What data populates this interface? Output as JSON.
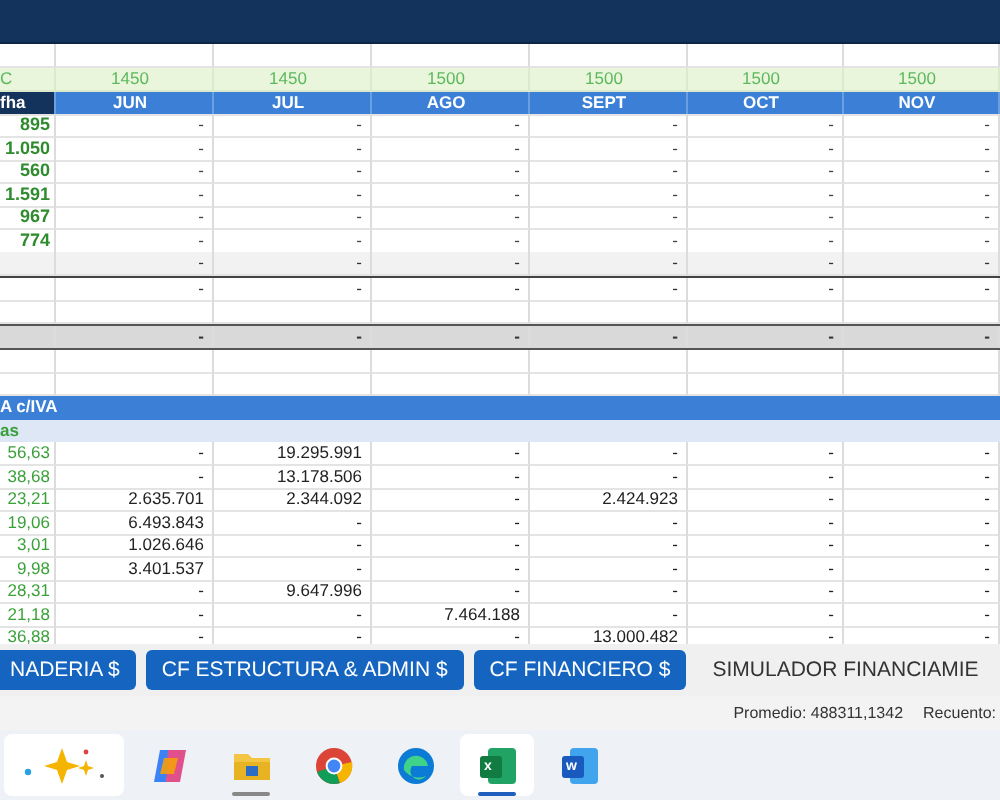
{
  "sheet": {
    "rate_row": [
      "C",
      "1450",
      "1450",
      "1500",
      "1500",
      "1500",
      "1500"
    ],
    "month_row": [
      "fha",
      "JUN",
      "JUL",
      "AGO",
      "SEPT",
      "OCT",
      "NOV"
    ],
    "rows": [
      {
        "kind": "top",
        "label": "895",
        "values": [
          "-",
          "-",
          "-",
          "-",
          "-",
          "-"
        ]
      },
      {
        "kind": "top",
        "label": "1.050",
        "values": [
          "-",
          "-",
          "-",
          "-",
          "-",
          "-"
        ]
      },
      {
        "kind": "top",
        "label": "560",
        "values": [
          "-",
          "-",
          "-",
          "-",
          "-",
          "-"
        ]
      },
      {
        "kind": "top",
        "label": "1.591",
        "values": [
          "-",
          "-",
          "-",
          "-",
          "-",
          "-"
        ]
      },
      {
        "kind": "top",
        "label": "967",
        "values": [
          "-",
          "-",
          "-",
          "-",
          "-",
          "-"
        ]
      },
      {
        "kind": "top",
        "label": "774",
        "values": [
          "-",
          "-",
          "-",
          "-",
          "-",
          "-"
        ]
      },
      {
        "kind": "shaded",
        "values": [
          "-",
          "-",
          "-",
          "-",
          "-",
          "-"
        ]
      },
      {
        "kind": "ruled",
        "values": [
          "-",
          "-",
          "-",
          "-",
          "-",
          "-"
        ]
      },
      {
        "kind": "blank"
      },
      {
        "kind": "total",
        "values": [
          "-",
          "-",
          "-",
          "-",
          "-",
          "-"
        ]
      },
      {
        "kind": "blank"
      },
      {
        "kind": "blank"
      },
      {
        "kind": "section",
        "label": "A c/IVA"
      },
      {
        "kind": "subsection",
        "label": "as"
      },
      {
        "kind": "detail",
        "label": "56,63",
        "values": [
          "-",
          "19.295.991",
          "-",
          "-",
          "-",
          "-"
        ]
      },
      {
        "kind": "detail",
        "label": "38,68",
        "values": [
          "-",
          "13.178.506",
          "-",
          "-",
          "-",
          "-"
        ]
      },
      {
        "kind": "detail",
        "label": "23,21",
        "values": [
          "2.635.701",
          "2.344.092",
          "-",
          "2.424.923",
          "-",
          "-"
        ]
      },
      {
        "kind": "detail",
        "label": "19,06",
        "values": [
          "6.493.843",
          "-",
          "-",
          "-",
          "-",
          "-"
        ]
      },
      {
        "kind": "detail",
        "label": "3,01",
        "values": [
          "1.026.646",
          "-",
          "-",
          "-",
          "-",
          "-"
        ]
      },
      {
        "kind": "detail",
        "label": "9,98",
        "values": [
          "3.401.537",
          "-",
          "-",
          "-",
          "-",
          "-"
        ]
      },
      {
        "kind": "detail",
        "label": "28,31",
        "values": [
          "-",
          "9.647.996",
          "-",
          "-",
          "-",
          "-"
        ]
      },
      {
        "kind": "detail",
        "label": "21,18",
        "values": [
          "-",
          "-",
          "7.464.188",
          "-",
          "-",
          "-"
        ]
      },
      {
        "kind": "detail",
        "label": "36,88",
        "values": [
          "-",
          "-",
          "-",
          "13.000.482",
          "-",
          "-"
        ]
      }
    ]
  },
  "sheet_tabs": [
    {
      "label": "NADERIA $",
      "color": "#1565c0"
    },
    {
      "label": "CF ESTRUCTURA & ADMIN $",
      "color": "#1565c0"
    },
    {
      "label": "CF FINANCIERO $",
      "color": "#1565c0"
    },
    {
      "label": "SIMULADOR FINANCIAMIE"
    }
  ],
  "status_bar": [
    "Promedio: 488311,1342",
    "Recuento:"
  ],
  "taskbar": [
    {
      "kind": "widgets",
      "running": false,
      "selected": true
    },
    {
      "kind": "copilot",
      "running": false,
      "selected": false
    },
    {
      "kind": "folder",
      "running": true,
      "selected": false
    },
    {
      "kind": "chrome",
      "running": false,
      "selected": false
    },
    {
      "kind": "edge",
      "running": false,
      "selected": false
    },
    {
      "kind": "excel",
      "glyph": "x",
      "running": true,
      "selected": true
    },
    {
      "kind": "word",
      "glyph": "w",
      "running": false,
      "selected": false
    }
  ]
}
